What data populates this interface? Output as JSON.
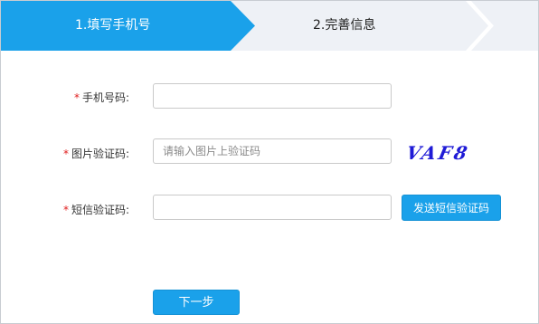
{
  "steps": [
    {
      "label": "1.填写手机号",
      "state": "active"
    },
    {
      "label": "2.完善信息",
      "state": "inactive"
    }
  ],
  "colors": {
    "accent": "#1aa1ea",
    "step_inactive": "#eef1f6",
    "required": "#e02020"
  },
  "form": {
    "required_mark": "*",
    "phone_label": "手机号码:",
    "phone_value": "",
    "captcha_label": "图片验证码:",
    "captcha_placeholder": "请输入图片上验证码",
    "captcha_image_text": "VAF8",
    "sms_label": "短信验证码:",
    "sms_value": "",
    "send_sms_button": "发送短信验证码",
    "next_button": "下一步"
  }
}
